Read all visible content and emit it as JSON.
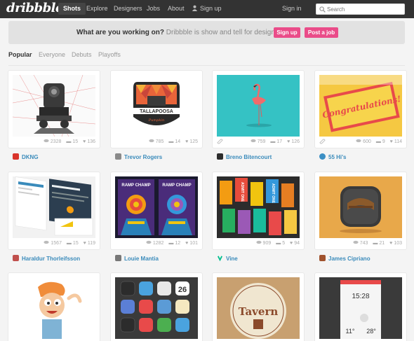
{
  "nav": {
    "logo": "dribbble",
    "links": [
      "Shots",
      "Explore",
      "Designers",
      "Jobs",
      "About"
    ],
    "signup": "Sign up",
    "signin": "Sign in",
    "search_placeholder": "Search"
  },
  "banner": {
    "question": "What are you working on?",
    "tagline": "Dribbble is show and tell for designers.",
    "signup_button": "Sign up",
    "post_job_button": "Post a job"
  },
  "tabs": [
    "Popular",
    "Everyone",
    "Debuts",
    "Playoffs"
  ],
  "shots": [
    {
      "author": "DKNG",
      "views": "2328",
      "comments": "15",
      "likes": "136",
      "avatar_color": "#d9342b"
    },
    {
      "author": "Trevor Rogers",
      "views": "785",
      "comments": "14",
      "likes": "125",
      "avatar_color": "#8a8a8a"
    },
    {
      "author": "Breno Bitencourt",
      "views": "759",
      "comments": "17",
      "likes": "126",
      "avatar_color": "#2c2c2c"
    },
    {
      "author": "55 Hi's",
      "views": "600",
      "comments": "9",
      "likes": "114",
      "avatar_color": "#3b8fc4"
    },
    {
      "author": "Haraldur Thorleifsson",
      "views": "1567",
      "comments": "15",
      "likes": "119",
      "avatar_color": "#c0504d"
    },
    {
      "author": "Louie Mantia",
      "views": "1282",
      "comments": "12",
      "likes": "101",
      "avatar_color": "#777"
    },
    {
      "author": "Vine",
      "views": "909",
      "comments": "5",
      "likes": "94",
      "avatar_color": "#00bf8f"
    },
    {
      "author": "James Cipriano",
      "views": "743",
      "comments": "21",
      "likes": "103",
      "avatar_color": "#a0522d"
    },
    {
      "author": "",
      "views": "",
      "comments": "",
      "likes": "",
      "avatar_color": "#ccc"
    },
    {
      "author": "",
      "views": "",
      "comments": "",
      "likes": "",
      "avatar_color": "#ccc"
    },
    {
      "author": "",
      "views": "",
      "comments": "",
      "likes": "",
      "avatar_color": "#ccc"
    },
    {
      "author": "",
      "views": "",
      "comments": "",
      "likes": "",
      "avatar_color": "#ccc"
    }
  ],
  "shot_texts": {
    "tallapoosa": "TALLAPOOSA",
    "tallapoosa_sub": "Pumpkin",
    "congrats": "Congratulations!",
    "ramp_champ": "RAMP CHAMP",
    "admit": "ADMIT ONE",
    "tavern": "Tavern",
    "time": "15:28",
    "temp_low": "11°",
    "temp_high": "28°"
  },
  "colors": {
    "accent": "#ea4c89",
    "nav_bg": "#333333",
    "link": "#3a8bbb"
  }
}
